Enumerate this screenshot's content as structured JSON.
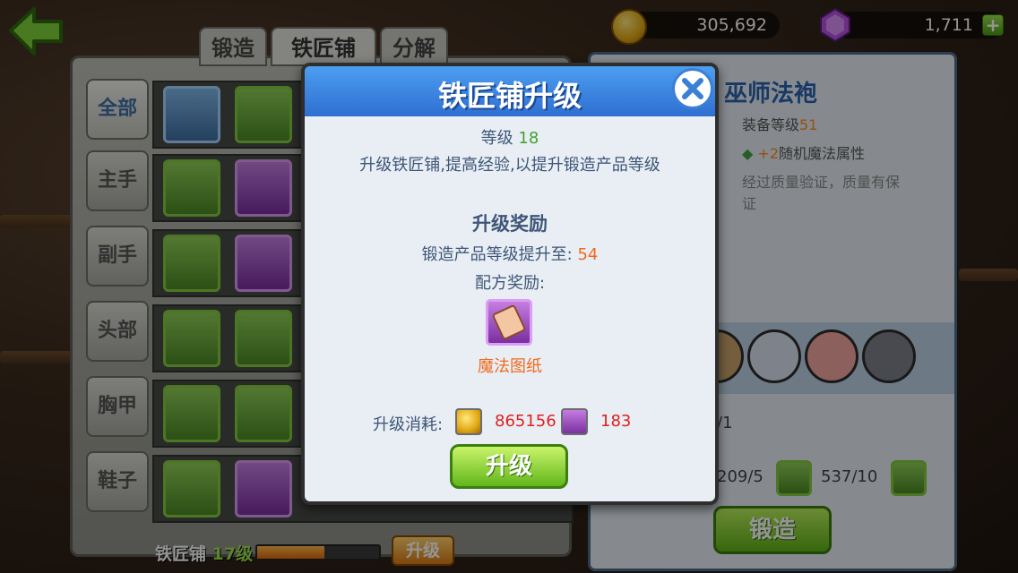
{
  "currency": {
    "gold": "305,692",
    "gems": "1,711",
    "plus_label": "+"
  },
  "tabs": {
    "forge": "锻造",
    "smithy": "铁匠铺",
    "disassemble": "分解"
  },
  "categories": [
    "全部",
    "主手",
    "副手",
    "头部",
    "胸甲",
    "鞋子"
  ],
  "bottom_bar": {
    "label": "铁匠铺",
    "level": "17级",
    "upgrade_label": "升级",
    "progress": 0.55
  },
  "detail": {
    "title": "巫师法袍",
    "equip_level_label": "装备等级",
    "equip_level": "51",
    "bonus_prefix": "+2",
    "bonus_text": "随机魔法属性",
    "desc": "经过质量验证，质量有保证",
    "counts": [
      "/1",
      "209/5",
      "537/10"
    ],
    "forge_label": "锻造"
  },
  "modal": {
    "title": "铁匠铺升级",
    "level_label": "等级",
    "level_value": "18",
    "desc": "升级铁匠铺,提高经验,以提升锻造产品等级",
    "reward_heading": "升级奖励",
    "product_level_label": "锻造产品等级提升至:",
    "product_level_value": "54",
    "recipe_label": "配方奖励:",
    "reward_name": "魔法图纸",
    "cost_label": "升级消耗:",
    "cost_gold": "865156",
    "cost_item": "183",
    "upgrade_button": "升级"
  },
  "colors": {
    "header_blue": "#2f6fd1",
    "green_button": "#62b61b",
    "cost_red": "#e02020",
    "highlight_orange": "#f06a1c",
    "level_green": "#45a12f"
  }
}
